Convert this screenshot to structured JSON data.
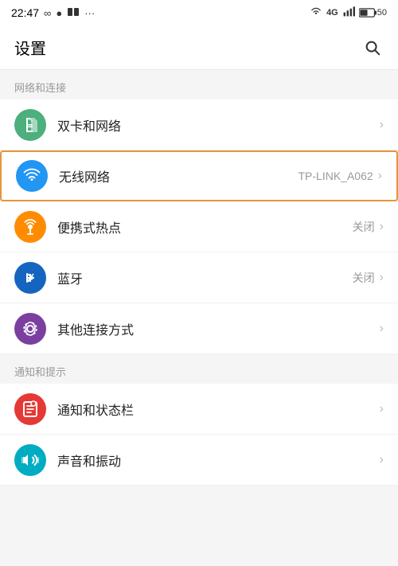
{
  "statusBar": {
    "time": "22:47",
    "batteryPercent": "50"
  },
  "header": {
    "title": "设置",
    "searchLabel": "搜索"
  },
  "sections": [
    {
      "id": "network",
      "label": "网络和连接",
      "items": [
        {
          "id": "dual-sim",
          "text": "双卡和网络",
          "sub": "",
          "iconColor": "green",
          "highlighted": false
        },
        {
          "id": "wifi",
          "text": "无线网络",
          "sub": "TP-LINK_A062",
          "iconColor": "blue",
          "highlighted": true
        },
        {
          "id": "hotspot",
          "text": "便携式热点",
          "sub": "关闭",
          "iconColor": "orange",
          "highlighted": false
        },
        {
          "id": "bluetooth",
          "text": "蓝牙",
          "sub": "关闭",
          "iconColor": "blue-dark",
          "highlighted": false
        },
        {
          "id": "other-connections",
          "text": "其他连接方式",
          "sub": "",
          "iconColor": "purple",
          "highlighted": false
        }
      ]
    },
    {
      "id": "notifications",
      "label": "通知和提示",
      "items": [
        {
          "id": "notification-bar",
          "text": "通知和状态栏",
          "sub": "",
          "iconColor": "red",
          "highlighted": false
        },
        {
          "id": "sound-vibrate",
          "text": "声音和振动",
          "sub": "",
          "iconColor": "teal",
          "highlighted": false
        }
      ]
    }
  ],
  "chevron": "›"
}
